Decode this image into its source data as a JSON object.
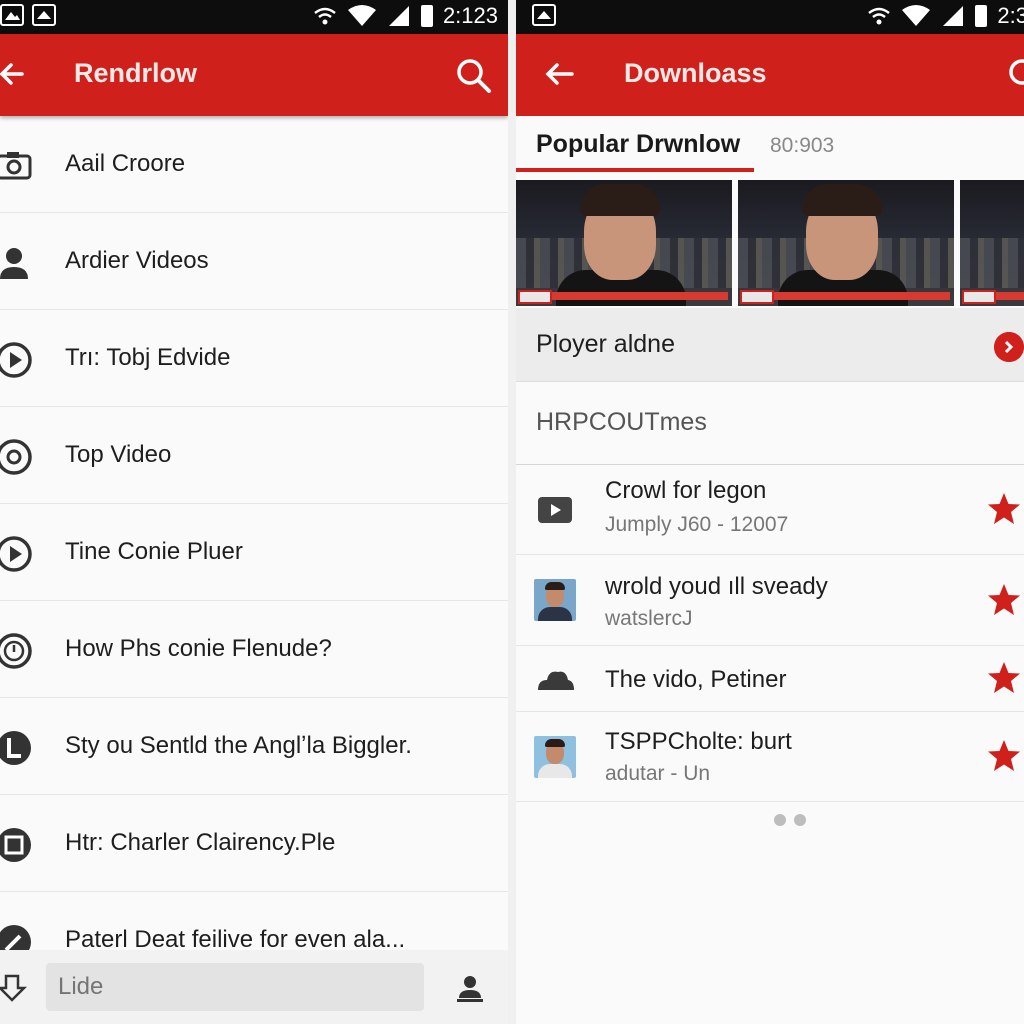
{
  "left": {
    "status": {
      "time": "2:123"
    },
    "appbar": {
      "title": "Rendrlow"
    },
    "menu": [
      {
        "label": "Aail Croore",
        "icon": "camera-icon"
      },
      {
        "label": "Ardier Videos",
        "icon": "person-icon"
      },
      {
        "label": "Trı: Tobj Edvide",
        "icon": "play-circle-icon"
      },
      {
        "label": "Top Video",
        "icon": "record-circle-icon"
      },
      {
        "label": "Tine Conie Pluer",
        "icon": "play-circle-icon"
      },
      {
        "label": "How Phs conie Flenude?",
        "icon": "clock-icon"
      },
      {
        "label": "Sty ou Sentld the Anglʼla Biggler.",
        "icon": "l-circle-icon"
      },
      {
        "label": "Htr: Charler Clairency.Ple",
        "icon": "square-circle-icon"
      },
      {
        "label": "Paterl Deat feilive for  even ala...",
        "icon": "edit-circle-icon"
      }
    ],
    "bottom": {
      "input_placeholder": "Lide"
    }
  },
  "right": {
    "status": {
      "time": "2:3"
    },
    "appbar": {
      "title": "Downloass"
    },
    "tabs": {
      "active": "Popular Drwnlow",
      "count": "80:903"
    },
    "player": {
      "label": "Ployer aldne"
    },
    "section": {
      "header": "HRPCOUTmes"
    },
    "list": [
      {
        "title": "Crowl for legon",
        "subtitle": "Jumply J60 - 12007",
        "thumb": "video-icon"
      },
      {
        "title": "wrold youd ıll sveady",
        "subtitle": "watslercJ",
        "thumb": "avatar"
      },
      {
        "title": "The vido, Petiner",
        "subtitle": "",
        "thumb": "cloud-icon"
      },
      {
        "title": "TSPPCholte: burt",
        "subtitle": "adutar - Un",
        "thumb": "avatar"
      }
    ]
  },
  "colors": {
    "accent": "#d0201b",
    "status_bar": "#0d0d0d",
    "star": "#d0201b"
  }
}
